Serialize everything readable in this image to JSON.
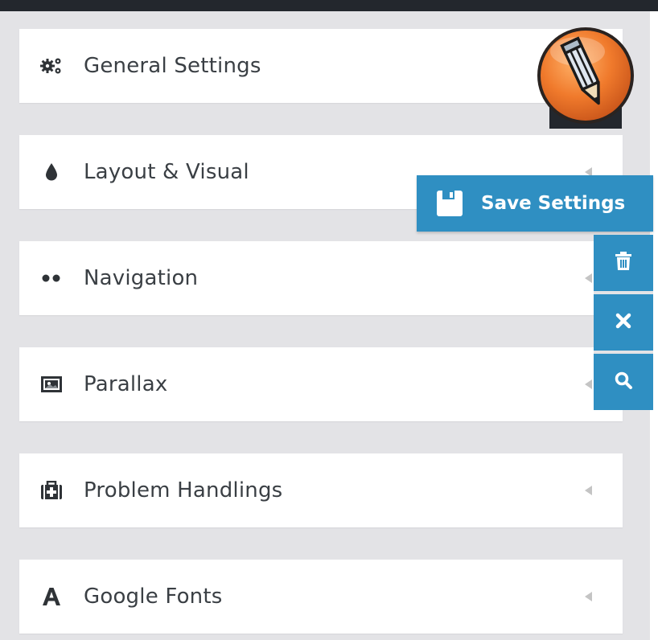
{
  "panels": [
    {
      "label": "General Settings",
      "icon": "gears-icon"
    },
    {
      "label": "Layout & Visual",
      "icon": "drop-icon"
    },
    {
      "label": "Navigation",
      "icon": "dots-icon"
    },
    {
      "label": "Parallax",
      "icon": "image-icon"
    },
    {
      "label": "Problem Handlings",
      "icon": "medkit-icon"
    },
    {
      "label": "Google Fonts",
      "icon": "font-icon"
    }
  ],
  "toolbar": {
    "save_label": "Save Settings",
    "actions": [
      "trash-icon",
      "close-icon",
      "search-icon"
    ]
  },
  "colors": {
    "accent": "#2f8fc2",
    "badge": "#f07a2c",
    "background": "#e3e3e6",
    "panel": "#ffffff"
  }
}
